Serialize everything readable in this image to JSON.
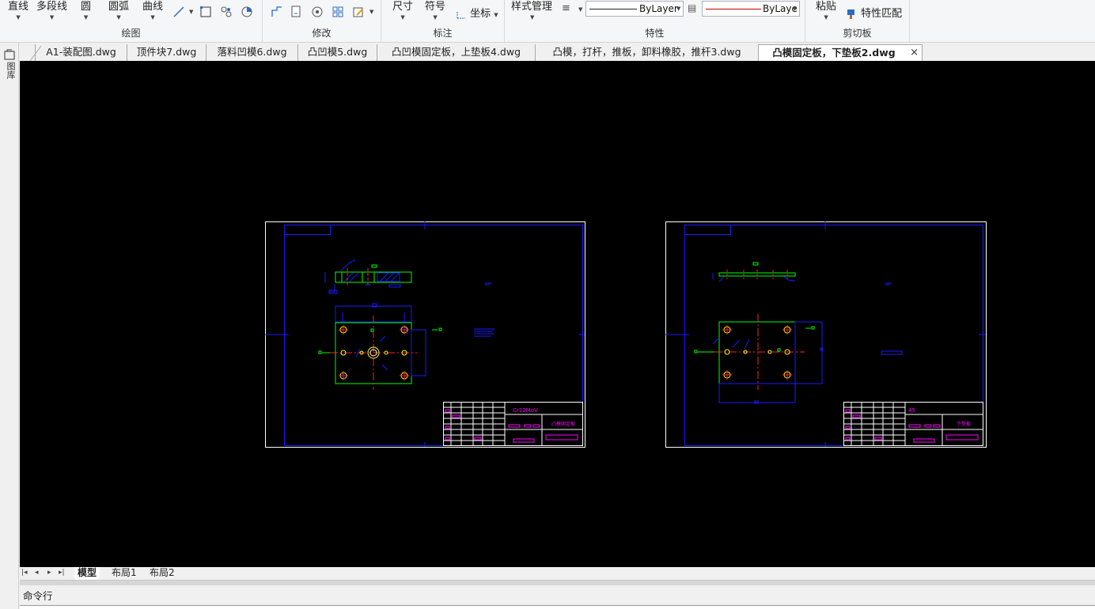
{
  "ribbon": {
    "draw": {
      "label": "绘图",
      "line": "直线",
      "polyline": "多段线",
      "circle": "圆",
      "arc": "圆弧",
      "curve": "曲线"
    },
    "modify": {
      "label": "修改"
    },
    "annotate": {
      "label": "标注",
      "dimension": "尺寸",
      "symbol": "符号",
      "coordinate": "坐标"
    },
    "properties": {
      "label": "特性",
      "style_manager": "样式管理",
      "linetype": "ByLayer",
      "lineweight": "ByLaye"
    },
    "clipboard": {
      "label": "剪切板",
      "paste": "粘贴",
      "match_properties": "特性匹配"
    }
  },
  "tabs": [
    {
      "label": "A1-装配图.dwg"
    },
    {
      "label": "顶件块7.dwg"
    },
    {
      "label": "落料凹模6.dwg"
    },
    {
      "label": "凸凹模5.dwg"
    },
    {
      "label": "凸凹模固定板，上垫板4.dwg"
    },
    {
      "label": "凸模，打杆，推板，卸料橡胶，推杆3.dwg"
    },
    {
      "label": "凸模固定板，下垫板2.dwg",
      "active": true
    }
  ],
  "tab_close": "×",
  "left_panel": {
    "label": "图库"
  },
  "drawing": {
    "sheet1": {
      "material": "Cr12MoV",
      "part_name": "凸模固定板"
    },
    "sheet2": {
      "material": "45",
      "part_name": "下垫板"
    }
  },
  "layout_tabs": {
    "model": "模型",
    "layout1": "布局1",
    "layout2": "布局2"
  },
  "nav": {
    "first": "|◂",
    "prev": "◂",
    "next": "▸",
    "last": "▸|"
  },
  "command": {
    "label": "命令行"
  },
  "colors": {
    "canvas": "#000000",
    "frame": "#0000ff",
    "border": "#ffffff",
    "part": "#00ff00",
    "center": "#ff0000",
    "text": "#ff00ff",
    "hole": "#ffff00"
  }
}
